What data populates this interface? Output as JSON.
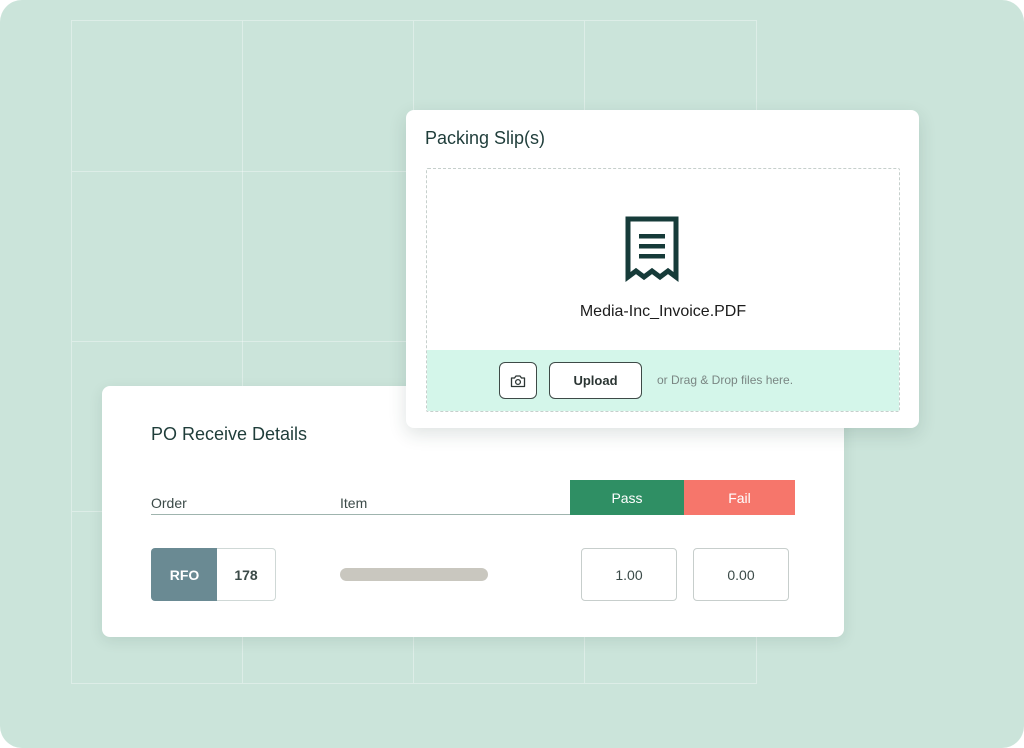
{
  "packing_slip": {
    "title": "Packing Slip(s)",
    "file_name": "Media-Inc_Invoice.PDF",
    "upload_label": "Upload",
    "drop_hint": "or Drag & Drop files here.",
    "file_icon": "receipt-icon",
    "camera_icon": "camera-icon"
  },
  "po_receive": {
    "title": "PO Receive Details",
    "columns": {
      "order": "Order",
      "item": "Item",
      "pass": "Pass",
      "fail": "Fail"
    },
    "row": {
      "order_prefix": "RFO",
      "order_number": "178",
      "pass_qty": "1.00",
      "fail_qty": "0.00"
    }
  },
  "colors": {
    "background": "#cbe4da",
    "pass": "#2f8f64",
    "fail": "#f6766b",
    "order_tag": "#6a8a93",
    "drop_footer": "#d4f6ea"
  }
}
